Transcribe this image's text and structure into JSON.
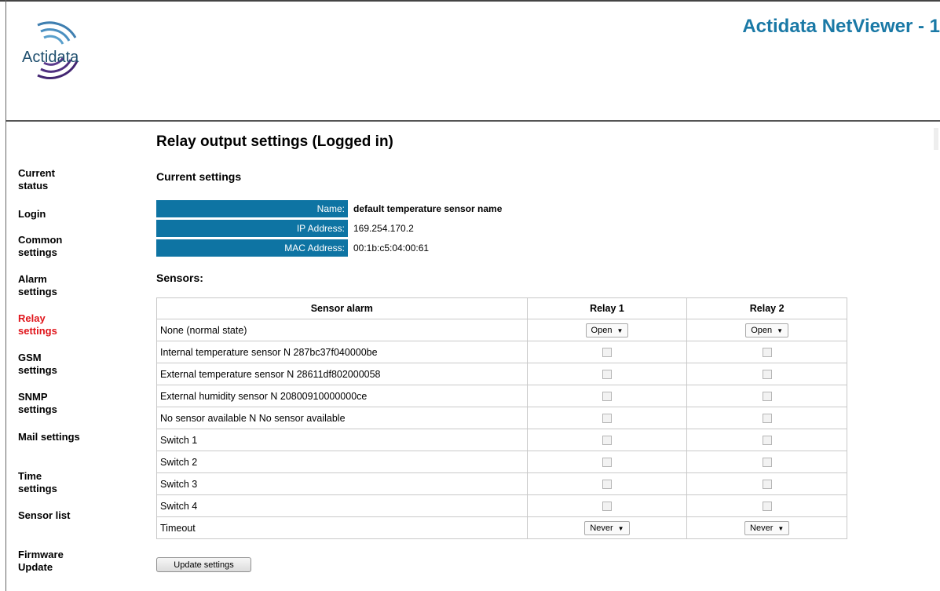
{
  "header": {
    "logo_text": "Actidata",
    "title": "Actidata NetViewer - 1"
  },
  "sidebar": {
    "items": [
      {
        "label": "Current status",
        "active": false
      },
      {
        "label": "Login",
        "active": false
      },
      {
        "label": "Common settings",
        "active": false
      },
      {
        "label": "Alarm settings",
        "active": false
      },
      {
        "label": "Relay settings",
        "active": true
      },
      {
        "label": "GSM settings",
        "active": false
      },
      {
        "label": "SNMP settings",
        "active": false
      },
      {
        "label": "Mail settings",
        "active": false
      },
      {
        "label": "Time settings",
        "active": false
      },
      {
        "label": "Sensor list",
        "active": false
      },
      {
        "label": "Firmware Update",
        "active": false
      }
    ]
  },
  "main": {
    "heading": "Relay output settings (Logged in)",
    "current_settings_heading": "Current settings",
    "info": [
      {
        "label": "Name:",
        "value": "default temperature sensor name"
      },
      {
        "label": "IP Address:",
        "value": "169.254.170.2"
      },
      {
        "label": "MAC Address:",
        "value": "00:1b:c5:04:00:61"
      }
    ],
    "sensors_heading": "Sensors:",
    "table": {
      "headers": [
        "Sensor alarm",
        "Relay 1",
        "Relay 2"
      ],
      "rows": [
        {
          "label": "None (normal state)",
          "type": "select",
          "relay1": "Open",
          "relay2": "Open"
        },
        {
          "label": "Internal temperature sensor N 287bc37f040000be",
          "type": "checkbox",
          "relay1": false,
          "relay2": false
        },
        {
          "label": "External temperature sensor N 28611df802000058",
          "type": "checkbox",
          "relay1": false,
          "relay2": false
        },
        {
          "label": "External humidity sensor N 20800910000000ce",
          "type": "checkbox",
          "relay1": false,
          "relay2": false
        },
        {
          "label": "No sensor available N No sensor available",
          "type": "checkbox",
          "relay1": false,
          "relay2": false
        },
        {
          "label": "Switch 1",
          "type": "checkbox",
          "relay1": false,
          "relay2": false
        },
        {
          "label": "Switch 2",
          "type": "checkbox",
          "relay1": false,
          "relay2": false
        },
        {
          "label": "Switch 3",
          "type": "checkbox",
          "relay1": false,
          "relay2": false
        },
        {
          "label": "Switch 4",
          "type": "checkbox",
          "relay1": false,
          "relay2": false
        },
        {
          "label": "Timeout",
          "type": "select",
          "relay1": "Never",
          "relay2": "Never"
        }
      ]
    },
    "update_button": "Update settings"
  },
  "colors": {
    "accent": "#0e74a3",
    "title": "#1a79a6",
    "active_nav": "#e0151b"
  }
}
